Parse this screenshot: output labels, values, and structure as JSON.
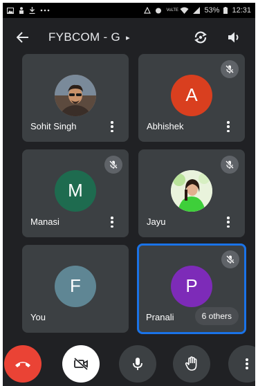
{
  "status_bar": {
    "left_icons": [
      "image-icon",
      "person-icon",
      "download-icon",
      "more-dots-icon"
    ],
    "right_icons": [
      "connect-icon",
      "alarm-icon",
      "volte-icon",
      "wifi-icon",
      "signal-icon"
    ],
    "battery": "53%",
    "time": "12:31",
    "volte_label": "VoLTE"
  },
  "header": {
    "title": "FYBCOM - G",
    "title_arrow": "▸",
    "back_icon": "arrow-back-icon",
    "switch_camera_icon": "switch-camera-icon",
    "speaker_icon": "speaker-icon"
  },
  "participants": [
    {
      "name": "Sohit Singh",
      "initial": "",
      "avatar_type": "photo",
      "muted": false
    },
    {
      "name": "Abhishek",
      "initial": "A",
      "avatar_color": "#d93f1f",
      "muted": true
    },
    {
      "name": "Manasi",
      "initial": "M",
      "avatar_color": "#1e6b4f",
      "muted": true
    },
    {
      "name": "Jayu",
      "initial": "",
      "avatar_type": "photo",
      "muted": true
    },
    {
      "name": "You",
      "initial": "F",
      "avatar_color": "#5f8694",
      "muted": false
    },
    {
      "name": "Pranali",
      "initial": "P",
      "avatar_color": "#7d2bb8",
      "muted": true,
      "active_speaker": true
    }
  ],
  "others_chip": "6 others",
  "controls": [
    {
      "name": "end-call",
      "icon": "call-end-icon",
      "color": "#ea4335"
    },
    {
      "name": "camera-toggle",
      "icon": "videocam-off-icon",
      "color": "#ffffff"
    },
    {
      "name": "microphone",
      "icon": "mic-icon",
      "color": "#3c4043"
    },
    {
      "name": "raise-hand",
      "icon": "hand-icon",
      "color": "#3c4043"
    },
    {
      "name": "more-options",
      "icon": "more-vert-icon",
      "color": "#3c4043"
    }
  ],
  "colors": {
    "background": "#202124",
    "tile": "#3c4043",
    "active_border": "#1a73e8"
  }
}
